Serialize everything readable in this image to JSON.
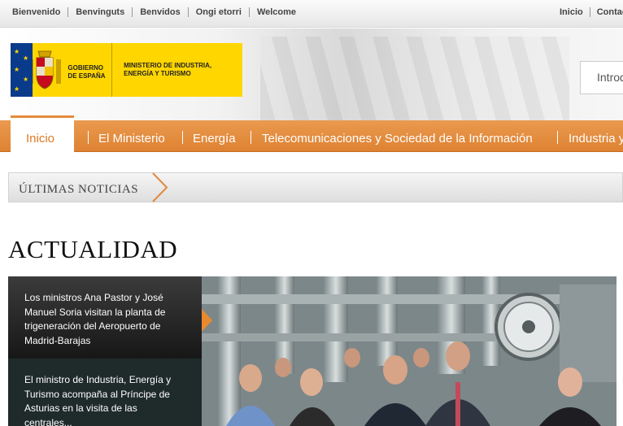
{
  "top_bar": {
    "languages": [
      "Bienvenido",
      "Benvinguts",
      "Benvidos",
      "Ongi etorri",
      "Welcome"
    ],
    "links": [
      "Inicio",
      "Contacto"
    ]
  },
  "header": {
    "gobierno": "GOBIERNO DE ESPAÑA",
    "ministerio": "MINISTERIO DE INDUSTRIA, ENERGÍA Y TURISMO",
    "search_placeholder": "Introduzca"
  },
  "nav": {
    "items": [
      "Inicio",
      "El Ministerio",
      "Energía",
      "Telecomunicaciones y Sociedad de la Información",
      "Industria y"
    ]
  },
  "news_bar": {
    "label": "ÚLTIMAS NOTICIAS"
  },
  "section": {
    "title": "ACTUALIDAD"
  },
  "carousel": {
    "stories": [
      "Los ministros Ana Pastor y José Manuel Soria visitan la planta de trigeneración del Aeropuerto de Madrid-Barajas",
      "El ministro de Industria, Energía y Turismo acompaña al Príncipe de Asturias en la visita de las centrales..."
    ]
  },
  "colors": {
    "accent": "#e08a3c",
    "logo_yellow": "#ffd600"
  }
}
